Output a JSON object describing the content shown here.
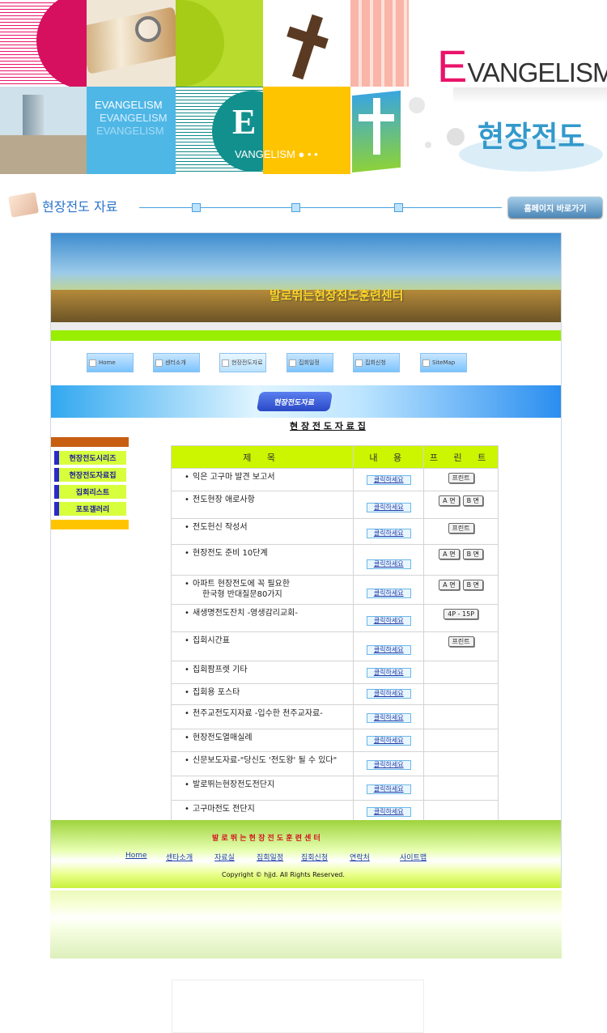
{
  "banner": {
    "logo_text": "VANGELISM",
    "logo_initial": "E",
    "korean_title": "현장전도",
    "tile_words": [
      "EVANGELISM",
      "EVANGELISM",
      "EVANGELISM"
    ],
    "tile_e_letter": "E",
    "tile_e_word": "VANGELISM ●  •  •"
  },
  "section_header": {
    "title": "현장전도 자료",
    "home_button": "홈페이지 바로가기"
  },
  "center": {
    "banner_text": "발로뛰는현장전도훈련센터",
    "nav": [
      "Home",
      "센터소개",
      "현장전도자료",
      "집회일정",
      "집회신청",
      "SiteMap"
    ],
    "section_badge": "현장전도자료",
    "page_heading": "현 장 전 도 자 료 집"
  },
  "sidebar": {
    "items": [
      "현장전도시리즈",
      "현장전도자료집",
      "집회리스트",
      "포토갤러리"
    ]
  },
  "table": {
    "headers": [
      "제   목",
      "내  용",
      "프 린 트"
    ],
    "view_label": "클릭하세요",
    "rows": [
      {
        "title": "익은 고구마 발견 보고서",
        "subtitle": "",
        "print": [
          "프린트"
        ]
      },
      {
        "title": "전도현장 애로사항",
        "subtitle": "",
        "print": [
          "A 면",
          "B 면"
        ]
      },
      {
        "title": "전도헌신   작성서",
        "subtitle": "",
        "print": [
          "프린트"
        ]
      },
      {
        "title": "현장전도 준비 10단계",
        "subtitle": "",
        "print": [
          "A 면",
          "B 면"
        ]
      },
      {
        "title": "아파트 현장전도에 꼭 필요한",
        "subtitle": "한국형 반대질문80가지",
        "print": [
          "A 면",
          "B 면"
        ]
      },
      {
        "title": "새생명전도잔치 -영생감리교회-",
        "subtitle": "",
        "print": [
          "4P - 15P"
        ]
      },
      {
        "title": "집회시간표",
        "subtitle": "",
        "print": [
          "프린트"
        ]
      },
      {
        "title": "집회팜프렛 기타",
        "subtitle": "",
        "print": []
      },
      {
        "title": "집회용 포스타",
        "subtitle": "",
        "print": []
      },
      {
        "title": "천주교전도지자료 -입수한 천주교자료-",
        "subtitle": "",
        "print": []
      },
      {
        "title": "현장전도열매실례",
        "subtitle": "",
        "print": []
      },
      {
        "title": "신문보도자료-\"당신도 '전도왕' 될 수 있다\"",
        "subtitle": "",
        "print": []
      },
      {
        "title": "발로뛰는현장전도전단지",
        "subtitle": "",
        "print": []
      },
      {
        "title": "고구마전도 전단지",
        "subtitle": "",
        "print": []
      }
    ]
  },
  "footer": {
    "center_name": "발 로 뛰 는 현 장 전 도 훈 련 센 터",
    "links": [
      "Home",
      "센타소개",
      "자료실",
      "집회일정",
      "집회신청",
      "연락처",
      "사이트맵"
    ],
    "copyright": "Copyright © hjjd. All Rights Reserved."
  },
  "colors": {
    "accent_pink": "#e9146a",
    "lime": "#ccf500",
    "sky": "#7cc4ff",
    "navy_text": "#1a1a99"
  }
}
